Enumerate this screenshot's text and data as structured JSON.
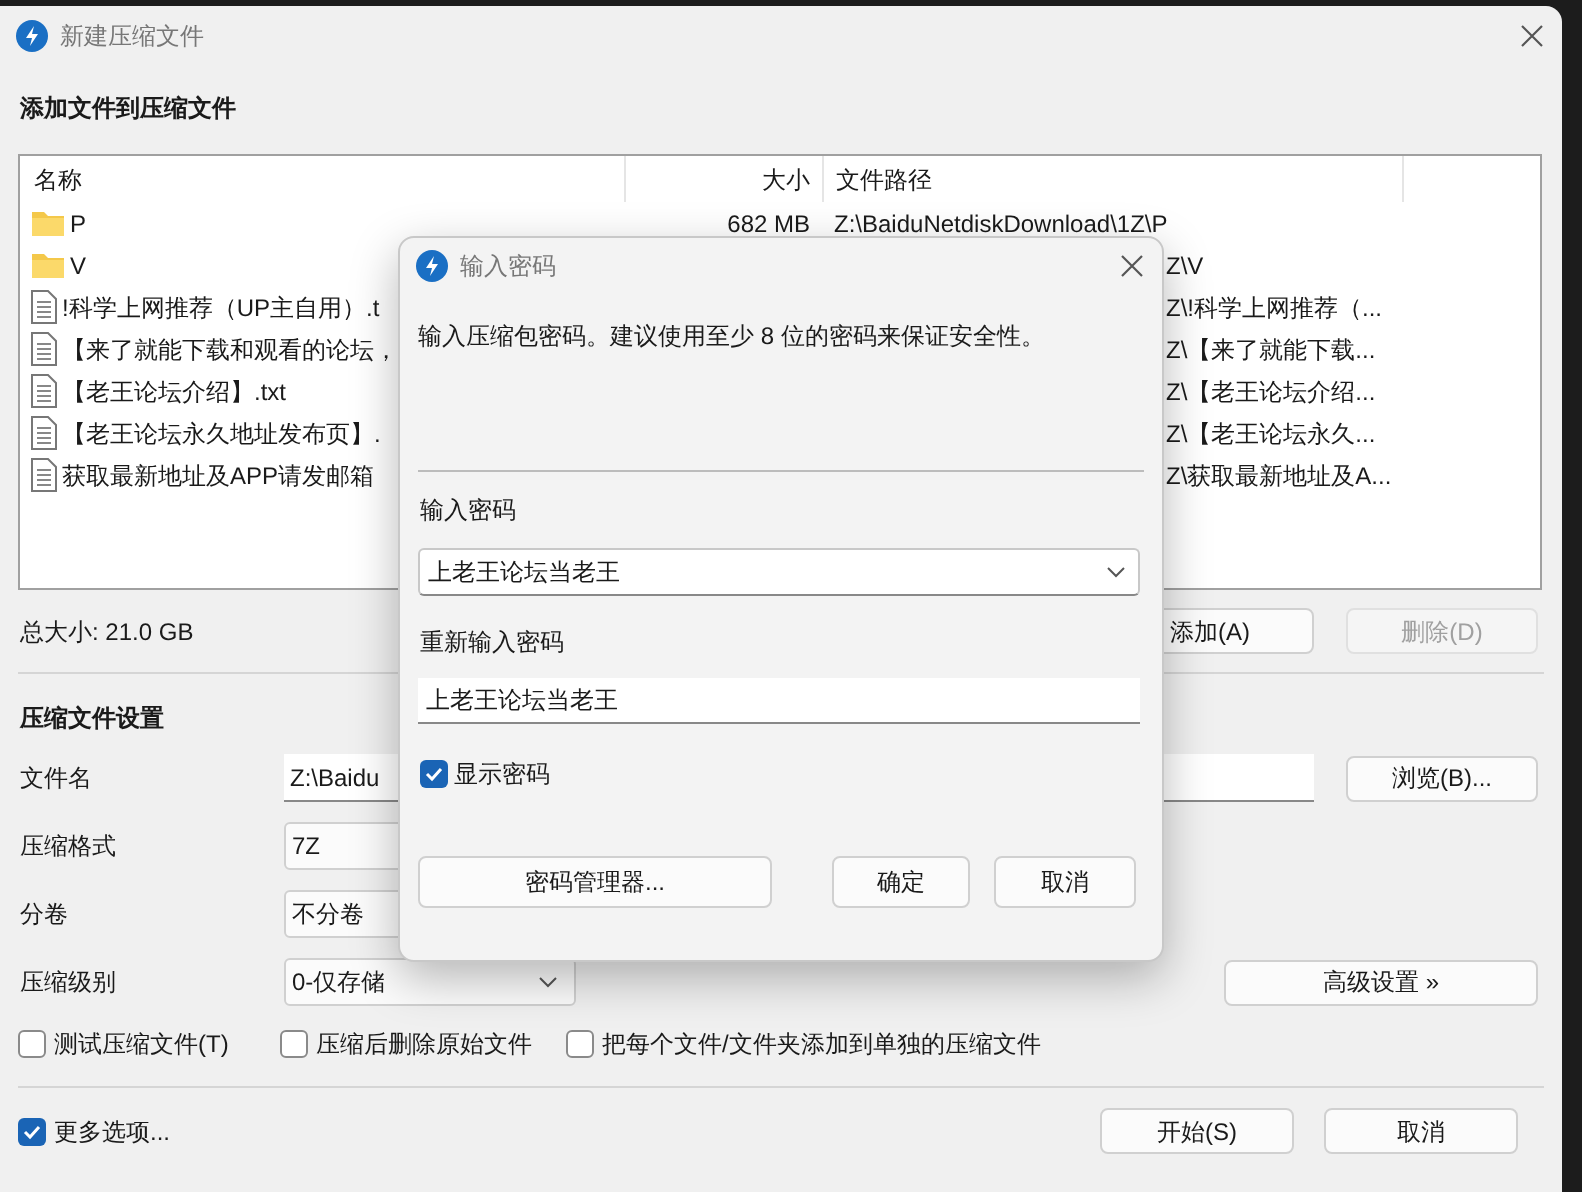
{
  "window": {
    "title": "新建压缩文件"
  },
  "files_section": {
    "heading": "添加文件到压缩文件"
  },
  "file_table": {
    "columns": [
      "名称",
      "大小",
      "文件路径"
    ],
    "rows": [
      {
        "kind": "folder",
        "name": "P",
        "size": "682 MB",
        "path": "Z:\\BaiduNetdiskDownload\\1Z\\P"
      },
      {
        "kind": "folder",
        "name": "V",
        "path": "Z\\V"
      },
      {
        "kind": "file",
        "name": "!科学上网推荐（UP主自用）.t",
        "path": "Z\\!科学上网推荐（..."
      },
      {
        "kind": "file",
        "name": "【来了就能下载和观看的论坛，",
        "path": "Z\\【来了就能下载..."
      },
      {
        "kind": "file",
        "name": "【老王论坛介绍】.txt",
        "path": "Z\\【老王论坛介绍..."
      },
      {
        "kind": "file",
        "name": "【老王论坛永久地址发布页】.",
        "path": "Z\\【老王论坛永久..."
      },
      {
        "kind": "file",
        "name": "获取最新地址及APP请发邮箱",
        "path": "Z\\获取最新地址及A..."
      }
    ]
  },
  "total_size": "总大小: 21.0 GB",
  "list_buttons": [
    {
      "label": "添加(A)",
      "disabled": false
    },
    {
      "label": "删除(D)",
      "disabled": true
    }
  ],
  "settings": {
    "heading": "压缩文件设置",
    "filename": {
      "label": "文件名",
      "value": "Z:\\Baidu",
      "browse": "浏览(B)..."
    },
    "format": {
      "label": "压缩格式",
      "value": "7Z"
    },
    "split": {
      "label": "分卷",
      "value": "不分卷"
    },
    "level": {
      "label": "压缩级别",
      "value": "0-仅存储"
    },
    "advanced": "高级设置 »",
    "options": [
      {
        "label": "测试压缩文件(T)",
        "checked": false
      },
      {
        "label": "压缩后删除原始文件",
        "checked": false
      },
      {
        "label": "把每个文件/文件夹添加到单独的压缩文件",
        "checked": false
      }
    ]
  },
  "more_options": {
    "label": "更多选项...",
    "checked": true
  },
  "footer_buttons": [
    "开始(S)",
    "取消"
  ],
  "password_dialog": {
    "title": "输入密码",
    "description": "输入压缩包密码。建议使用至少 8 位的密码来保证安全性。",
    "password_label": "输入密码",
    "password": "上老王论坛当老王",
    "repeat_label": "重新输入密码",
    "repeat": "上老王论坛当老王",
    "show_password": {
      "label": "显示密码",
      "checked": true
    },
    "buttons": [
      "密码管理器...",
      "确定",
      "取消"
    ]
  }
}
